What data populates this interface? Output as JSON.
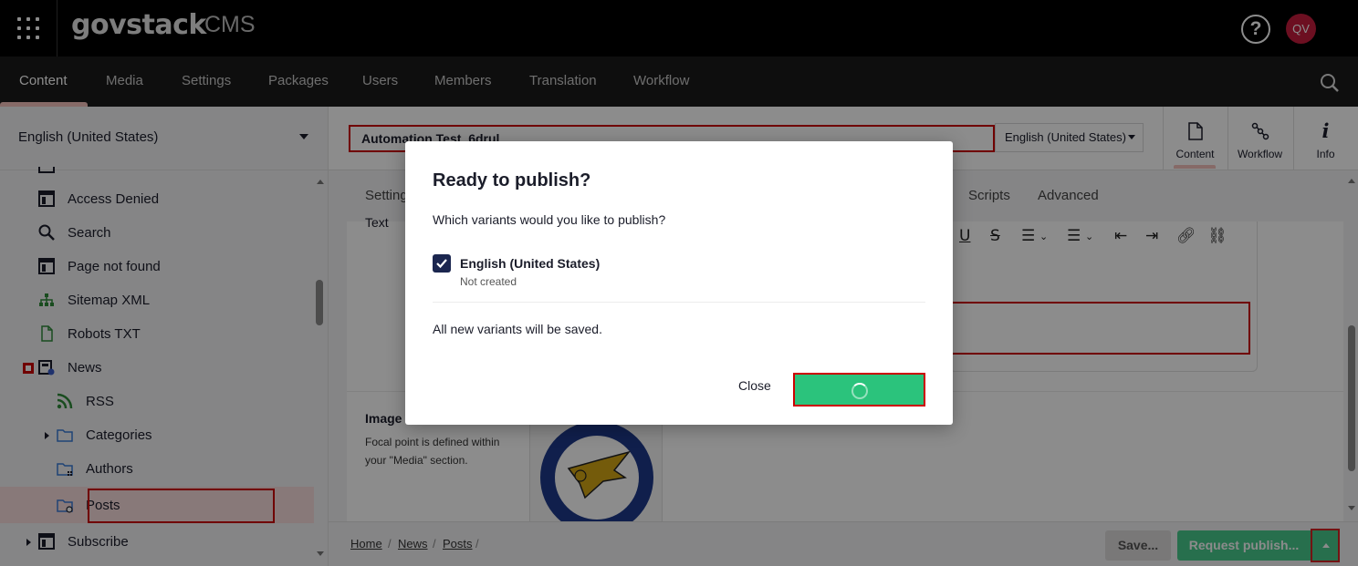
{
  "header": {
    "brand": "govstack",
    "product": "CMS",
    "help_icon": "?",
    "user_initials": "QV"
  },
  "nav": {
    "items": [
      "Content",
      "Media",
      "Settings",
      "Packages",
      "Users",
      "Members",
      "Translation",
      "Workflow"
    ],
    "active": "Content"
  },
  "sidebar": {
    "language": "English (United States)",
    "tree": [
      {
        "label": "Access Denied",
        "icon": "layout-icon"
      },
      {
        "label": "Search",
        "icon": "search-icon"
      },
      {
        "label": "Page not found",
        "icon": "layout-icon"
      },
      {
        "label": "Sitemap XML",
        "icon": "sitemap-icon"
      },
      {
        "label": "Robots TXT",
        "icon": "document-icon"
      },
      {
        "label": "News",
        "icon": "news-icon"
      },
      {
        "label": "RSS",
        "icon": "rss-icon"
      },
      {
        "label": "Categories",
        "icon": "folder-icon"
      },
      {
        "label": "Authors",
        "icon": "folder-icon"
      },
      {
        "label": "Posts",
        "icon": "folder-icon"
      },
      {
        "label": "Subscribe",
        "icon": "layout-icon"
      }
    ]
  },
  "editor": {
    "name_value": "Automation Test_6drul",
    "variant": "English (United States)",
    "apps": [
      {
        "label": "Content",
        "icon": "document-icon"
      },
      {
        "label": "Workflow",
        "icon": "workflow-icon"
      },
      {
        "label": "Info",
        "icon": "info-icon"
      }
    ],
    "tabs": [
      "Settings",
      "Scripts",
      "Advanced"
    ],
    "text_label": "Text",
    "image_label": "Image",
    "image_desc": "Focal point is defined within your \"Media\" section.",
    "breadcrumb": [
      "Home",
      "News",
      "Posts"
    ],
    "save_label": "Save...",
    "request_label": "Request publish..."
  },
  "dialog": {
    "title": "Ready to publish?",
    "question": "Which variants would you like to publish?",
    "variant_name": "English (United States)",
    "variant_status": "Not created",
    "variant_checked": true,
    "note": "All new variants will be saved.",
    "close_label": "Close"
  },
  "colors": {
    "accent_green": "#2bc37c",
    "avatar_red": "#c51d3d",
    "highlight_red": "#cc0000",
    "checkbox_navy": "#1b264f"
  }
}
